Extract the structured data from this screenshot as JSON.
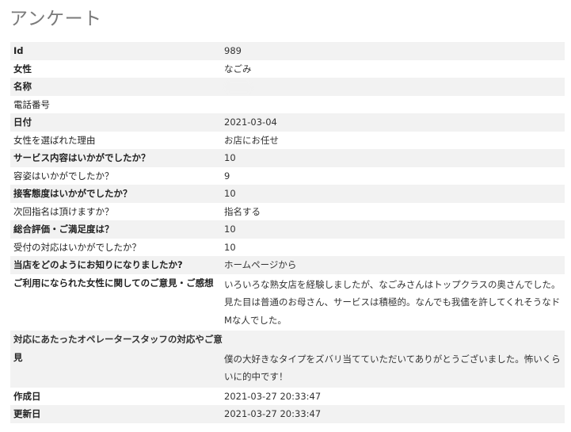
{
  "page": {
    "title": "アンケート"
  },
  "rows": [
    {
      "label": "Id",
      "value": "989"
    },
    {
      "label": "女性",
      "value": "なごみ"
    },
    {
      "label": "名称",
      "value": ""
    },
    {
      "label": "電話番号",
      "value": ""
    },
    {
      "label": "日付",
      "value": "2021-03-04"
    },
    {
      "label": "女性を選ばれた理由",
      "value": "お店にお任せ"
    },
    {
      "label": "サービス内容はいかがでしたか？",
      "value": "10"
    },
    {
      "label": "容姿はいかがでしたか？",
      "value": "9"
    },
    {
      "label": "接客態度はいかがでしたか？",
      "value": "10"
    },
    {
      "label": "次回指名は頂けますか？",
      "value": "指名する"
    },
    {
      "label": "総合評価・ご満足度は？",
      "value": "10"
    },
    {
      "label": "受付の対応はいかがでしたか？",
      "value": "10"
    },
    {
      "label": "当店をどのようにお知りになりましたか?",
      "value": "ホームページから"
    },
    {
      "label": "ご利用になられた女性に関してのご意見・ご感想",
      "value": "いろいろな熟女店を経験しましたが、なごみさんはトップクラスの奥さんでした。見た目は普通のお母さん、サービスは積極的。なんでも我儘を許してくれそうなドMな人でした。"
    },
    {
      "label_line1": "対応にあたったオペレータースタッフの対応やご意",
      "label_line2": "見",
      "value": "僕の大好きなタイプをズバリ当てていただいてありがとうございました。怖いくらいに的中です！"
    },
    {
      "label": "作成日",
      "value": "2021-03-27 20:33:47"
    },
    {
      "label": "更新日",
      "value": "2021-03-27 20:33:47"
    }
  ]
}
